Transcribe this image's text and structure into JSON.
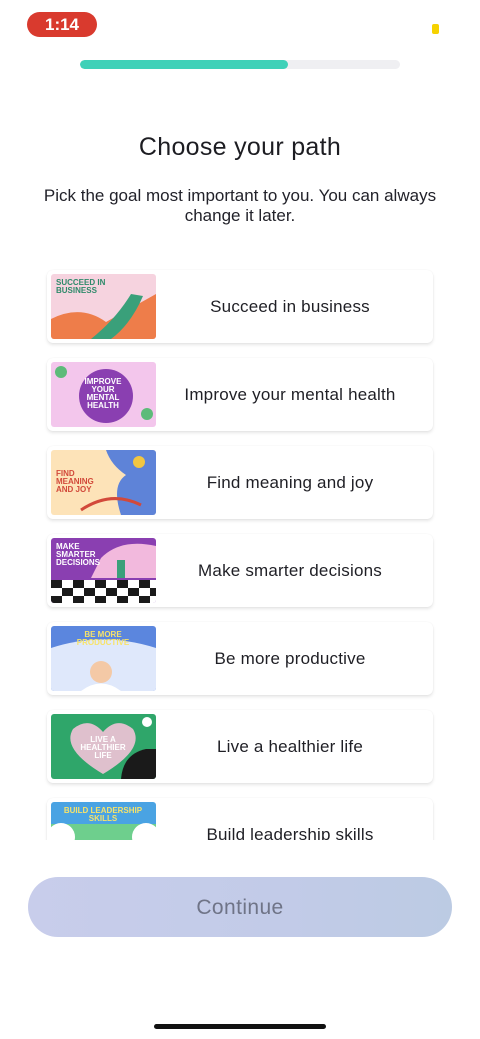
{
  "status_bar": {
    "time": "1:14"
  },
  "progress": {
    "fraction": 0.65
  },
  "header": {
    "title": "Choose your path",
    "subtitle": "Pick the goal most important to you. You can always change it later."
  },
  "paths": [
    {
      "label": "Succeed in business",
      "thumb_text": [
        "SUCCEED IN",
        "BUSINESS"
      ],
      "colors": {
        "bg": "#f6d3df",
        "accent": "#3aa07a",
        "text": "#2e8a6a"
      }
    },
    {
      "label": "Improve your mental health",
      "thumb_text": [
        "IMPROVE",
        "YOUR",
        "MENTAL",
        "HEALTH"
      ],
      "colors": {
        "bg": "#f3c6ec",
        "accent": "#8a3fb1",
        "text": "#ffffff"
      }
    },
    {
      "label": "Find meaning and joy",
      "thumb_text": [
        "FIND",
        "MEANING",
        "AND JOY"
      ],
      "colors": {
        "bg": "#fde3b8",
        "accent": "#5e83d8",
        "text": "#d2493a"
      }
    },
    {
      "label": "Make smarter decisions",
      "thumb_text": [
        "MAKE",
        "SMARTER",
        "DECISIONS"
      ],
      "colors": {
        "bg": "#8a3fb1",
        "accent": "#f2b9dd",
        "text": "#ffffff"
      }
    },
    {
      "label": "Be more productive",
      "thumb_text": [
        "BE MORE",
        "PRODUCTIVE"
      ],
      "colors": {
        "bg": "#5b86de",
        "accent": "#dfe8fb",
        "text": "#f7e36a"
      }
    },
    {
      "label": "Live a healthier life",
      "thumb_text": [
        "LIVE A",
        "HEALTHIER",
        "LIFE"
      ],
      "colors": {
        "bg": "#2fa66a",
        "accent": "#f3c3d8",
        "text": "#ffffff"
      }
    },
    {
      "label": "Build leadership skills",
      "thumb_text": [
        "BUILD LEADERSHIP",
        "SKILLS"
      ],
      "colors": {
        "bg": "#4aa3e3",
        "accent": "#6ecf8d",
        "text": "#f7e36a"
      }
    }
  ],
  "continue_label": "Continue"
}
